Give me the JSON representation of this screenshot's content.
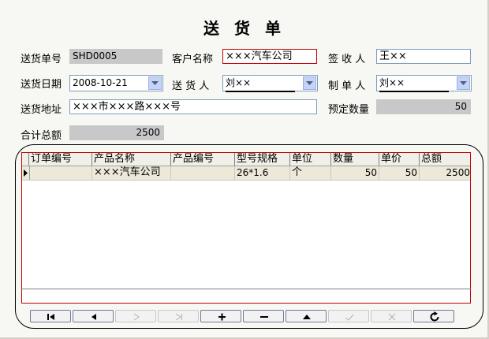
{
  "form": {
    "title": "送 货 单",
    "delivery_no_label": "送货单号",
    "delivery_no": "SHD0005",
    "customer_label": "客户名称",
    "customer": "×××汽车公司",
    "receiver_label": "签 收 人",
    "receiver": "王××",
    "date_label": "送货日期",
    "date": "2008-10-21",
    "sender_label": "送 货 人",
    "sender": "刘××",
    "maker_label": "制 单 人",
    "maker": "刘××",
    "address_label": "送货地址",
    "address": "×××市×××路×××号",
    "planned_qty_label": "预定数量",
    "planned_qty": "50",
    "total_label": "合计总额",
    "total": "2500"
  },
  "grid": {
    "columns": [
      "订单编号",
      "产品名称",
      "产品编号",
      "型号规格",
      "单位",
      "数量",
      "单价",
      "总额"
    ],
    "rows": [
      {
        "order_no": "",
        "product_name": "×××汽车公司",
        "product_no": "",
        "spec": "26*1.6",
        "unit": "个",
        "qty": "50",
        "price": "50",
        "amount": "2500"
      }
    ]
  },
  "navigator": {
    "buttons": [
      "first",
      "prior",
      "next",
      "last",
      "insert",
      "delete",
      "edit",
      "post",
      "cancel",
      "refresh"
    ],
    "disabled": [
      "next",
      "last",
      "post",
      "cancel"
    ]
  },
  "colors": {
    "required_border": "#c00000",
    "readonly_fill": "#c8c8c8",
    "row_fill": "#ece9d8"
  }
}
